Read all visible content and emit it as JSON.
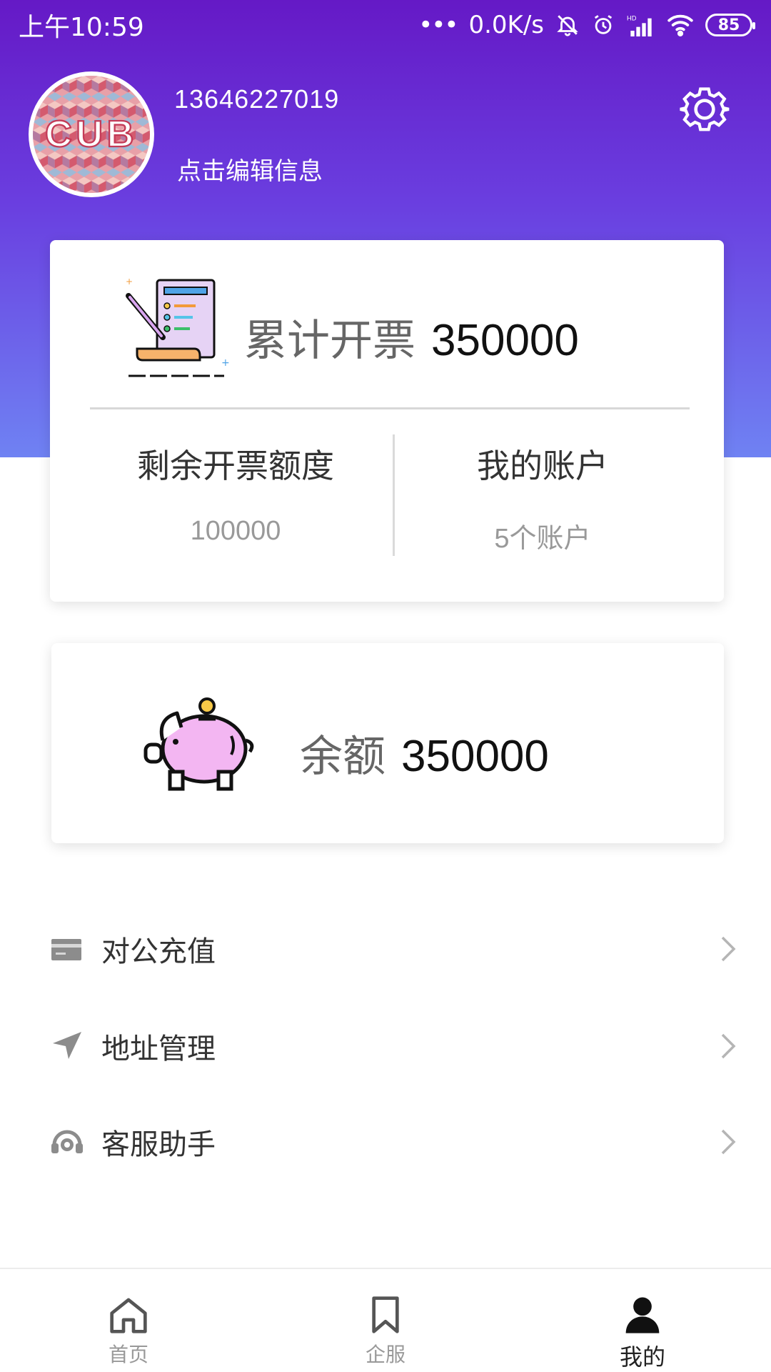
{
  "status_bar": {
    "time": "上午10:59",
    "network_speed": "0.0K/s",
    "battery": "85",
    "icons": [
      "bell-muted-icon",
      "alarm-icon",
      "hd-signal-icon",
      "wifi-icon",
      "battery-icon"
    ]
  },
  "profile": {
    "avatar_text": "CUB",
    "phone": "13646227019",
    "edit_label": "点击编辑信息"
  },
  "invoice_card": {
    "total_label": "累计开票",
    "total_value": "350000",
    "remaining_label": "剩余开票额度",
    "remaining_value": "100000",
    "accounts_label": "我的账户",
    "accounts_value": "5个账户"
  },
  "balance_card": {
    "label": "余额",
    "value": "350000"
  },
  "menu": {
    "items": [
      {
        "label": "对公充值",
        "icon": "card-icon"
      },
      {
        "label": "地址管理",
        "icon": "location-arrow-icon"
      },
      {
        "label": "客服助手",
        "icon": "headset-icon"
      }
    ]
  },
  "tabbar": {
    "tabs": [
      {
        "label": "首页",
        "icon": "home-icon"
      },
      {
        "label": "企服",
        "icon": "bookmark-icon"
      },
      {
        "label": "我的",
        "icon": "person-icon"
      }
    ],
    "active_index": 2
  },
  "colors": {
    "header_top": "#6519c6",
    "header_bottom": "#6f82f3",
    "text_primary": "#333333",
    "text_muted": "#999999"
  }
}
